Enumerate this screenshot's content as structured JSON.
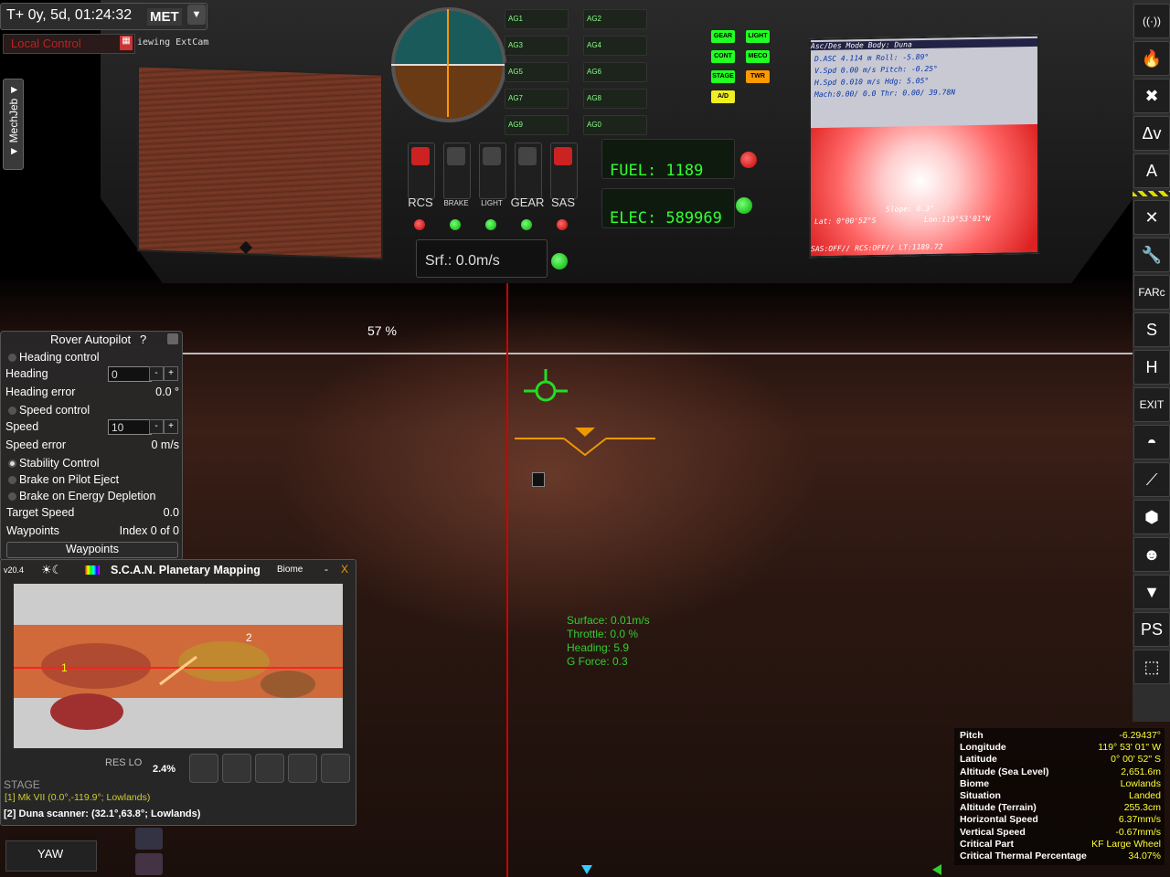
{
  "met": {
    "time": "T+ 0y, 5d, 01:24:32",
    "label": "MET",
    "arrow": "▼"
  },
  "local_control": {
    "label": "Local Control",
    "calc": "▦"
  },
  "extcam": {
    "label": "iewing ExtCam"
  },
  "mechjeb": {
    "label": "▼ MechJeb ▼"
  },
  "ags": [
    "AG1",
    "AG2",
    "AG3",
    "AG4",
    "AG5",
    "AG6",
    "AG7",
    "AG8",
    "AG9",
    "AG0"
  ],
  "status_buttons": [
    {
      "label": "GEAR",
      "color": "#2f2"
    },
    {
      "label": "LIGHT",
      "color": "#2f2"
    },
    {
      "label": "CONT",
      "color": "#2f2"
    },
    {
      "label": "MECO",
      "color": "#2f2"
    },
    {
      "label": "STAGE",
      "color": "#2f2"
    },
    {
      "label": "TWR",
      "color": "#f90"
    },
    {
      "label": "A/D",
      "color": "#ee2"
    }
  ],
  "switches": [
    {
      "label": "RCS",
      "small": false
    },
    {
      "label": "BRAKE",
      "small": true
    },
    {
      "label": "LIGHT",
      "small": true
    },
    {
      "label": "GEAR",
      "small": false
    },
    {
      "label": "SAS",
      "small": false
    }
  ],
  "readouts": {
    "fuel": "FUEL:  1189",
    "elec": "ELEC: 589969",
    "srf": "Srf.: 0.0m/s"
  },
  "mfd": {
    "header": "Asc/Des Mode       Body: Duna",
    "lines": [
      "D.ASC 4.114 m          Roll:  -5.89°",
      "V.Spd  0.00 m/s       Pitch:  -0.25°",
      "H.Spd 0.010 m/s         Hdg:   5.05°",
      "Mach:0.00/ 0.0        Thr:  0.00/  39.78N"
    ],
    "slope": "Slope: 6.3°",
    "lat": "Lat:  0°00'52\"S",
    "lon": "Lon:119°53'01\"W",
    "footer": "SAS:OFF// RCS:OFF// LT:1189.72"
  },
  "scene": {
    "throttle_pct": "57 %",
    "flight_stats": [
      "Surface: 0.01m/s",
      "Throttle: 0.0 %",
      "Heading: 5.9",
      "G Force: 0.3"
    ]
  },
  "rover": {
    "title": "Rover Autopilot",
    "help": "?",
    "heading_control": "Heading control",
    "heading_label": "Heading",
    "heading_value": "0",
    "heading_error_label": "Heading error",
    "heading_error_value": "0.0 °",
    "speed_control": "Speed control",
    "speed_label": "Speed",
    "speed_value": "10",
    "speed_error_label": "Speed error",
    "speed_error_value": "0 m/s",
    "stability": "Stability Control",
    "brake_eject": "Brake on Pilot Eject",
    "brake_energy": "Brake on Energy Depletion",
    "target_speed_label": "Target Speed",
    "target_speed_value": "0.0",
    "waypoints_label": "Waypoints",
    "waypoints_value": "Index 0 of 0",
    "waypoints_button": "Waypoints",
    "minus": "-",
    "plus": "+"
  },
  "scan": {
    "version": "v20.4",
    "title": "S.C.A.N. Planetary Mapping",
    "mode": "Biome",
    "minimize": "-",
    "close": "X",
    "marker1": "1",
    "marker2": "2",
    "res_lo": "RES LO",
    "pct": "2.4%",
    "line1": "[1] Mk VII (0.0°,-119.9°; Lowlands)",
    "line2": "[2] Duna scanner: (32.1°,63.8°; Lowlands)"
  },
  "nav": {
    "yaw": "YAW",
    "stage": "STAGE"
  },
  "info": [
    {
      "k": "Pitch",
      "v": "-6.29437°"
    },
    {
      "k": "Longitude",
      "v": "119° 53' 01\" W"
    },
    {
      "k": "Latitude",
      "v": "0° 00' 52\" S"
    },
    {
      "k": "Altitude (Sea Level)",
      "v": "2,651.6m"
    },
    {
      "k": "Biome",
      "v": "Lowlands"
    },
    {
      "k": "Situation",
      "v": "Landed"
    },
    {
      "k": "Altitude (Terrain)",
      "v": "255.3cm"
    },
    {
      "k": "Horizontal Speed",
      "v": "6.37mm/s"
    },
    {
      "k": "Vertical Speed",
      "v": "-0.67mm/s"
    },
    {
      "k": "Critical Part",
      "v": "KF Large Wheel"
    },
    {
      "k": "Critical Thermal Percentage",
      "v": "34.07%"
    }
  ],
  "toolbar": [
    {
      "name": "antenna-icon",
      "glyph": "((·))"
    },
    {
      "name": "fuel-icon",
      "glyph": "🔥"
    },
    {
      "name": "tools-icon",
      "glyph": "✖"
    },
    {
      "name": "delta-v-icon",
      "glyph": "Δv"
    },
    {
      "name": "kerbal-alarm-icon",
      "glyph": "A"
    },
    {
      "name": "wrench-cross-icon",
      "glyph": "✕"
    },
    {
      "name": "wrench-icon",
      "glyph": "🔧"
    },
    {
      "name": "farc-icon",
      "glyph": "FARc"
    },
    {
      "name": "route-icon",
      "glyph": "S"
    },
    {
      "name": "hangar-icon",
      "glyph": "H"
    },
    {
      "name": "exit-icon",
      "glyph": "EXIT"
    },
    {
      "name": "mechjeb-icon",
      "glyph": "◓"
    },
    {
      "name": "robot-arm-icon",
      "glyph": "⟋"
    },
    {
      "name": "green-cube-icon",
      "glyph": "⬢"
    },
    {
      "name": "kerbal-icon",
      "glyph": "☻"
    },
    {
      "name": "wolf-icon",
      "glyph": "▼"
    },
    {
      "name": "ps-icon",
      "glyph": "PS"
    },
    {
      "name": "cargo-icon",
      "glyph": "⬚"
    }
  ]
}
